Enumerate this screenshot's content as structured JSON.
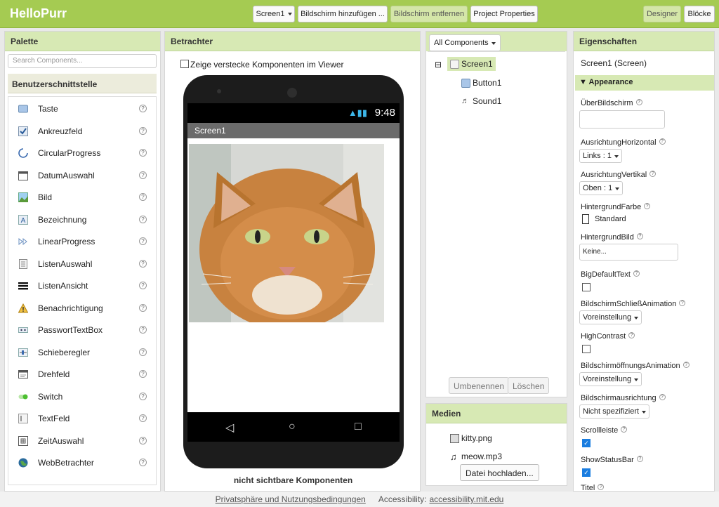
{
  "app": {
    "title": "HelloPurr"
  },
  "toolbar": {
    "screen_select": "Screen1",
    "add_screen": "Bildschirm hinzufügen ...",
    "remove_screen": "Bildschirm entfernen",
    "project_properties": "Project Properties",
    "designer": "Designer",
    "blocks": "Blöcke"
  },
  "palette": {
    "title": "Palette",
    "search_placeholder": "Search Components...",
    "category": "Benutzerschnittstelle",
    "help_glyph": "?",
    "items": [
      {
        "label": "Taste",
        "icon": "button-icon"
      },
      {
        "label": "Ankreuzfeld",
        "icon": "checkbox-icon"
      },
      {
        "label": "CircularProgress",
        "icon": "circular-progress-icon"
      },
      {
        "label": "DatumAuswahl",
        "icon": "date-picker-icon"
      },
      {
        "label": "Bild",
        "icon": "image-icon"
      },
      {
        "label": "Bezeichnung",
        "icon": "label-icon"
      },
      {
        "label": "LinearProgress",
        "icon": "linear-progress-icon"
      },
      {
        "label": "ListenAuswahl",
        "icon": "list-picker-icon"
      },
      {
        "label": "ListenAnsicht",
        "icon": "list-view-icon"
      },
      {
        "label": "Benachrichtigung",
        "icon": "notifier-icon"
      },
      {
        "label": "PasswortTextBox",
        "icon": "password-icon"
      },
      {
        "label": "Schieberegler",
        "icon": "slider-icon"
      },
      {
        "label": "Drehfeld",
        "icon": "spinner-icon"
      },
      {
        "label": "Switch",
        "icon": "switch-icon"
      },
      {
        "label": "TextFeld",
        "icon": "textbox-icon"
      },
      {
        "label": "ZeitAuswahl",
        "icon": "time-picker-icon"
      },
      {
        "label": "WebBetrachter",
        "icon": "web-viewer-icon"
      }
    ]
  },
  "viewer": {
    "title": "Betrachter",
    "show_hidden": "Zeige verstecke Komponenten im Viewer",
    "status_time": "9:48",
    "screen_title": "Screen1",
    "non_visible": "nicht sichtbare Komponenten"
  },
  "components": {
    "dropdown": "All Components",
    "tree": [
      {
        "label": "Screen1",
        "icon": "screen-icon"
      },
      {
        "label": "Button1",
        "icon": "button-icon"
      },
      {
        "label": "Sound1",
        "icon": "sound-icon"
      }
    ],
    "rename": "Umbenennen",
    "delete": "Löschen"
  },
  "media": {
    "title": "Medien",
    "files": [
      {
        "label": "kitty.png",
        "icon": "image-file-icon"
      },
      {
        "label": "meow.mp3",
        "icon": "audio-file-icon"
      }
    ],
    "upload": "Datei hochladen..."
  },
  "properties": {
    "title": "Eigenschaften",
    "subtitle": "Screen1 (Screen)",
    "section": "Appearance",
    "about": "ÜberBildschirm",
    "align_h": "AusrichtungHorizontal",
    "align_h_value": "Links : 1",
    "align_v": "AusrichtungVertikal",
    "align_v_value": "Oben : 1",
    "bg_color": "HintergrundFarbe",
    "bg_color_value": "Standard",
    "bg_image": "HintergrundBild",
    "bg_image_value": "Keine...",
    "big_text": "BigDefaultText",
    "big_text_checked": false,
    "close_anim": "BildschirmSchließAnimation",
    "close_anim_value": "Voreinstellung",
    "high_contrast": "HighContrast",
    "high_contrast_checked": false,
    "open_anim": "BildschirmöffnungsAnimation",
    "open_anim_value": "Voreinstellung",
    "orientation": "Bildschirmausrichtung",
    "orientation_value": "Nicht spezifiziert",
    "scrollbar": "Scrollleiste",
    "scrollbar_checked": true,
    "status_bar": "ShowStatusBar",
    "status_bar_checked": true,
    "title_prop": "Titel"
  },
  "footer": {
    "privacy": "Privatsphäre und Nutzungsbedingungen",
    "accessibility_label": "Accessibility:",
    "accessibility_link": "accessibility.mit.edu"
  },
  "colors": {
    "accent": "#a5cb52",
    "header": "#d7e9b4",
    "checked": "#1a7de0"
  }
}
